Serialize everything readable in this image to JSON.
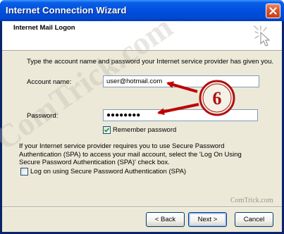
{
  "window": {
    "title": "Internet Connection Wizard"
  },
  "header": {
    "title": "Internet Mail Logon",
    "icon": "sparkle-cursor-icon"
  },
  "intro_text": "Type the account name and password your Internet service provider has given you.",
  "account": {
    "label": "Account name:",
    "value": "user@hotmail.com"
  },
  "password": {
    "label": "Password:",
    "value": "●●●●●●●●"
  },
  "remember_password": {
    "label": "Remember password",
    "checked": true
  },
  "spa_paragraph": "If your Internet service provider requires you to use Secure Password Authentication (SPA) to access your mail account, select the 'Log On Using Secure Password Authentication (SPA)' check box.",
  "spa_checkbox": {
    "label": "Log on using Secure Password Authentication (SPA)",
    "checked": false
  },
  "buttons": {
    "back": "< Back",
    "next": "Next >",
    "cancel": "Cancel"
  },
  "annotation": {
    "number": "6",
    "color": "#b01010"
  },
  "watermark": {
    "large": "ComTrick.com",
    "small": "ComTrick.com"
  }
}
